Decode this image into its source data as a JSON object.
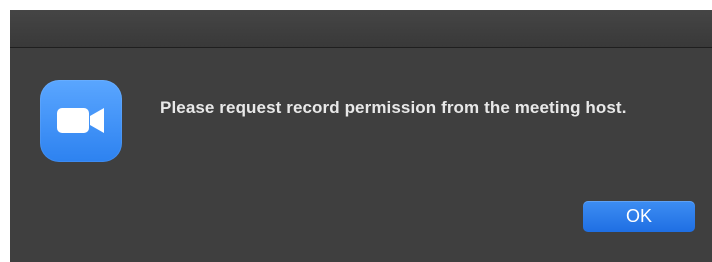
{
  "dialog": {
    "message": "Please request record permission from the meeting host.",
    "ok_label": "OK"
  },
  "icons": {
    "app": "zoom-video-camera-icon"
  },
  "colors": {
    "dialog_background": "#3f3f3f",
    "message_text": "#e8e8e8",
    "button_background": "#2a7ff0",
    "icon_background": "#3b8cf7"
  }
}
